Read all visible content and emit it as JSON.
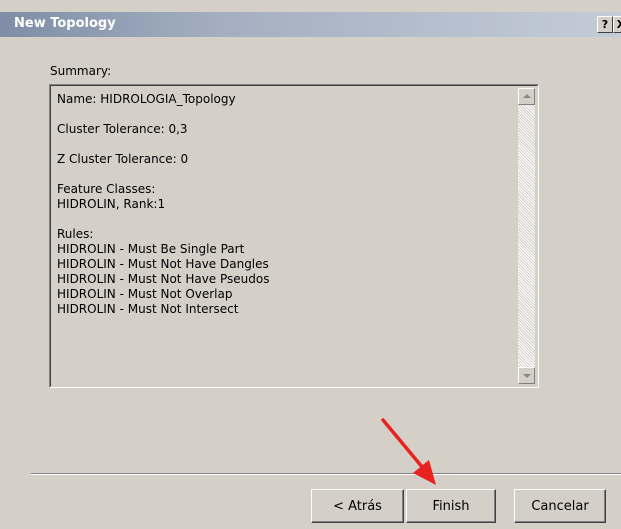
{
  "window": {
    "title": "New Topology",
    "help_label": "?",
    "close_label": "X"
  },
  "summary": {
    "label": "Summary:",
    "content": "Name: HIDROLOGIA_Topology\n\nCluster Tolerance: 0,3\n\nZ Cluster Tolerance: 0\n\nFeature Classes:\nHIDROLIN, Rank:1\n\nRules:\nHIDROLIN - Must Be Single Part\nHIDROLIN - Must Not Have Dangles\nHIDROLIN - Must Not Have Pseudos\nHIDROLIN - Must Not Overlap\nHIDROLIN - Must Not Intersect"
  },
  "buttons": {
    "back": "< Atrás",
    "finish": "Finish",
    "cancel": "Cancelar"
  },
  "colors": {
    "annotation_arrow": "#e8231f",
    "dialog_face": "#d4d0c8"
  }
}
